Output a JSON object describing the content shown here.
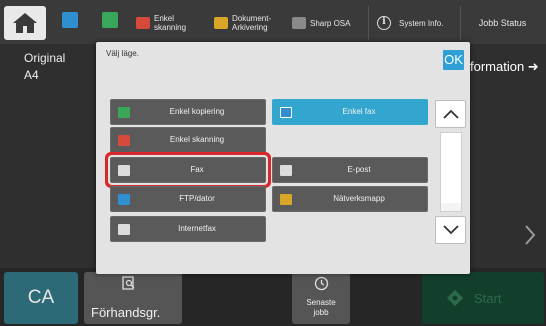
{
  "topbar": {
    "home_icon": "home-icon",
    "items": [
      {
        "label": "",
        "icon": "copy-icon",
        "color": "#2f8fd0"
      },
      {
        "label": "",
        "icon": "document-icon",
        "color": "#3aa65a"
      },
      {
        "label": "Enkel\nskanning",
        "icon": "scan-icon",
        "color": "#d64a3c"
      },
      {
        "label": "Dokument-\nArkivering",
        "icon": "folder-icon",
        "color": "#d9a627"
      },
      {
        "label": "Sharp OSA",
        "icon": "osa-icon",
        "color": "#8a8a8a"
      }
    ],
    "system_info": "System Info.",
    "job_status": "Jobb Status"
  },
  "background": {
    "original_label": "Original",
    "original_size": "A4",
    "info_link": "formation ➜",
    "ca": "CA",
    "preview": "Förhandsgr.",
    "recent_jobs": "Senaste\njobb",
    "start": "Start"
  },
  "dialog": {
    "title": "Välj läge.",
    "ok": "OK",
    "options": [
      {
        "label": "Enkel kopiering",
        "icon": "copy-icon",
        "color": "#3aa65a",
        "selected": false
      },
      {
        "label": "Enkel fax",
        "icon": "fax-icon",
        "color": "#2f8fd0",
        "selected": true
      },
      {
        "label": "Enkel skanning",
        "icon": "scan-icon",
        "color": "#d64a3c",
        "selected": false
      },
      {
        "label": "Fax",
        "icon": "fax-icon",
        "color": "#dcdcdc",
        "selected": false,
        "highlighted": true
      },
      {
        "label": "E-post",
        "icon": "mail-icon",
        "color": "#dcdcdc",
        "selected": false
      },
      {
        "label": "FTP/dator",
        "icon": "ftp-icon",
        "color": "#2f8fd0",
        "selected": false
      },
      {
        "label": "Nätverksmapp",
        "icon": "folder-icon",
        "color": "#d9a627",
        "selected": false
      },
      {
        "label": "Internetfax",
        "icon": "internet-fax-icon",
        "color": "#dcdcdc",
        "selected": false
      }
    ]
  },
  "colors": {
    "accent": "#33a6cf",
    "highlight_frame": "#d9272e",
    "ca_button": "#2d6a78",
    "start_button": "#123f2c"
  }
}
